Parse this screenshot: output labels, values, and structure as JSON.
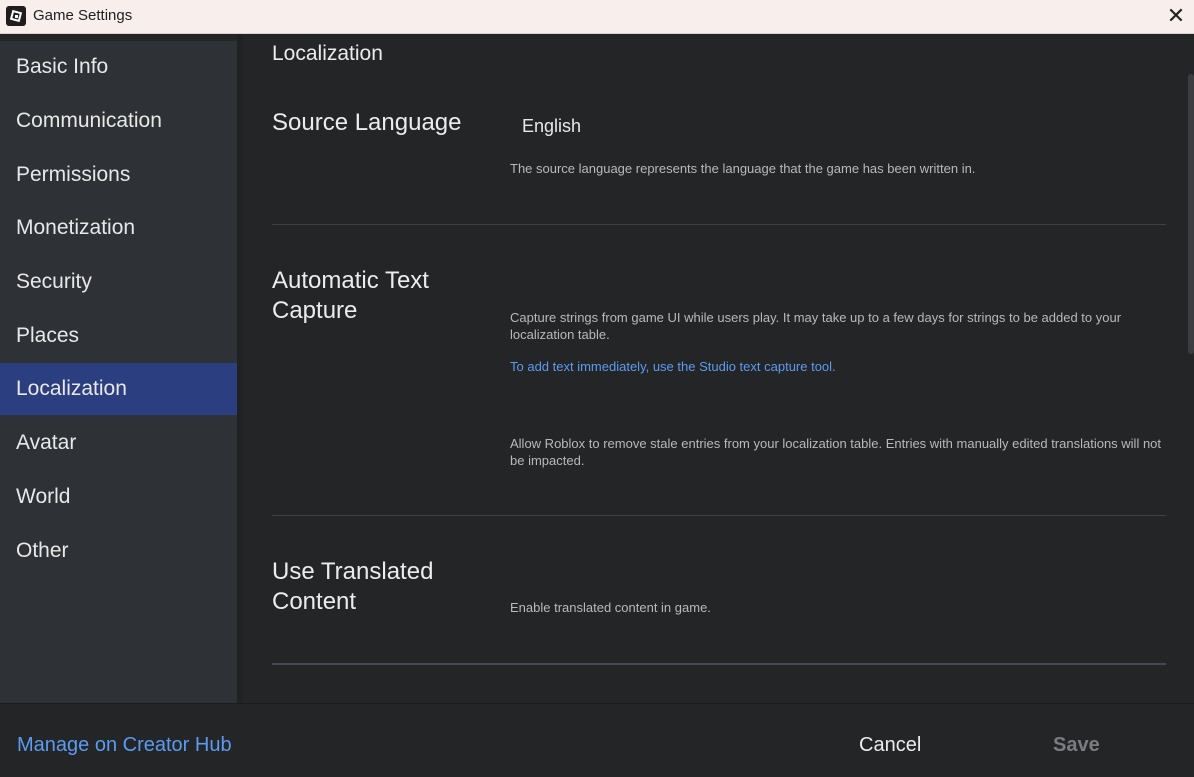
{
  "window": {
    "title": "Game Settings",
    "close_glyph": "✕"
  },
  "sidebar": {
    "items": [
      {
        "label": "Basic Info"
      },
      {
        "label": "Communication"
      },
      {
        "label": "Permissions"
      },
      {
        "label": "Monetization"
      },
      {
        "label": "Security"
      },
      {
        "label": "Places"
      },
      {
        "label": "Localization",
        "active": true
      },
      {
        "label": "Avatar"
      },
      {
        "label": "World"
      },
      {
        "label": "Other"
      }
    ]
  },
  "main": {
    "page_title": "Localization",
    "source_language": {
      "title": "Source Language",
      "value": "English",
      "description": "The source language represents the language that the game has been written in."
    },
    "auto_capture": {
      "title_line1": "Automatic Text",
      "title_line2": "Capture",
      "description": "Capture strings from game UI while users play. It may take up to a few days for strings to be added to your localization table.",
      "link": "To add text immediately, use the Studio text capture tool.",
      "stale_description": "Allow Roblox to remove stale entries from your localization table. Entries with manually edited translations will not be impacted."
    },
    "translated_content": {
      "title_line1": "Use Translated",
      "title_line2": "Content",
      "description": "Enable translated content in game."
    }
  },
  "footer": {
    "creator_hub": "Manage on Creator Hub",
    "cancel": "Cancel",
    "save": "Save"
  },
  "colors": {
    "accent": "#2b3f80",
    "link": "#5c9bf0",
    "background": "#232527",
    "sidebar": "#2e3135"
  }
}
